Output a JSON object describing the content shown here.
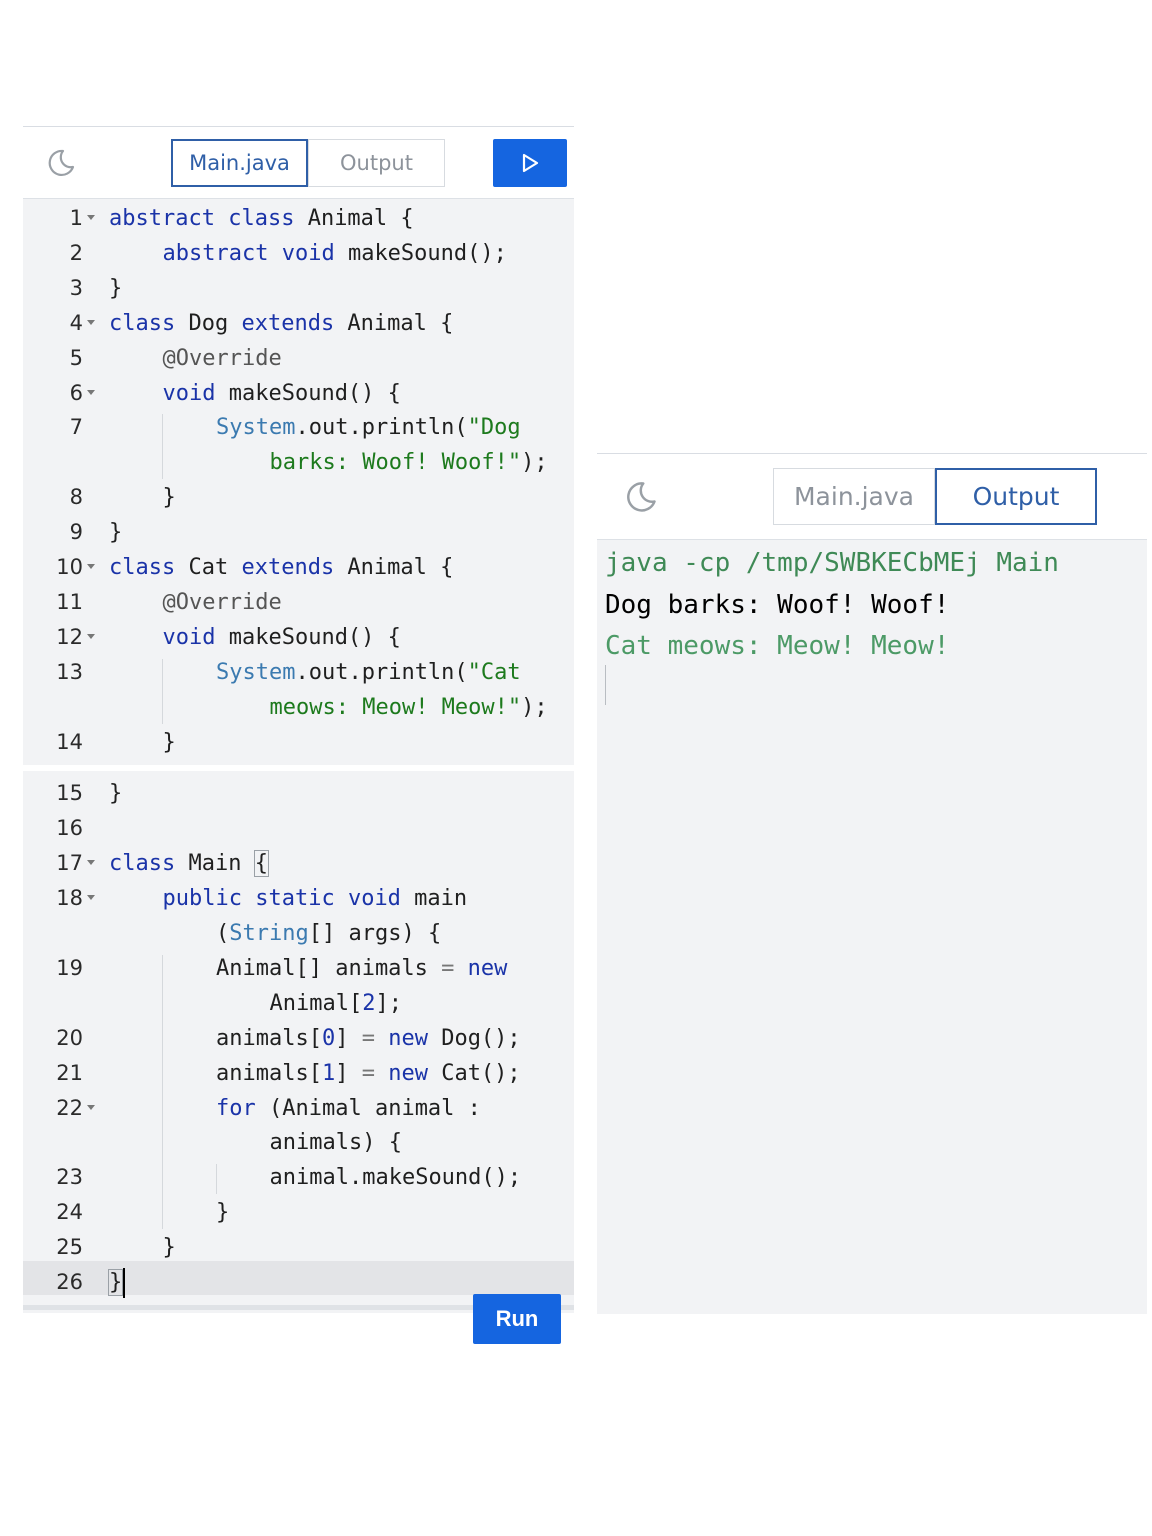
{
  "editor": {
    "tabs": [
      "Main.java",
      "Output"
    ],
    "active_tab": "Main.java",
    "run_label": "Run",
    "lines": [
      {
        "n": "1",
        "fold": true,
        "tokens": [
          [
            "kw",
            "abstract"
          ],
          [
            "",
            ""
          ],
          [
            "kw",
            " class"
          ],
          [
            "",
            " Animal {"
          ]
        ]
      },
      {
        "n": "2",
        "fold": false,
        "indent": 1,
        "tokens": [
          [
            "kw",
            "abstract"
          ],
          [
            "kw",
            " void"
          ],
          [
            "",
            " makeSound();"
          ]
        ]
      },
      {
        "n": "3",
        "fold": false,
        "tokens": [
          [
            "",
            "}"
          ]
        ]
      },
      {
        "n": "4",
        "fold": true,
        "tokens": [
          [
            "kw",
            "class"
          ],
          [
            "",
            " Dog "
          ],
          [
            "kw",
            "extends"
          ],
          [
            "",
            " Animal {"
          ]
        ]
      },
      {
        "n": "5",
        "fold": false,
        "indent": 1,
        "tokens": [
          [
            "an",
            "@Override"
          ]
        ]
      },
      {
        "n": "6",
        "fold": true,
        "indent": 1,
        "tokens": [
          [
            "kw",
            "void"
          ],
          [
            "",
            " makeSound() {"
          ]
        ]
      },
      {
        "n": "7",
        "fold": false,
        "indent": 2,
        "tokens": [
          [
            "ty",
            "System"
          ],
          [
            "",
            ".out.println("
          ],
          [
            "st",
            "\"Dog"
          ]
        ]
      },
      {
        "n": "",
        "fold": false,
        "indent": 3,
        "tokens": [
          [
            "st",
            "barks: Woof! Woof!\""
          ],
          [
            "",
            ");"
          ]
        ]
      },
      {
        "n": "8",
        "fold": false,
        "indent": 1,
        "tokens": [
          [
            "",
            "}"
          ]
        ]
      },
      {
        "n": "9",
        "fold": false,
        "tokens": [
          [
            "",
            "}"
          ]
        ]
      },
      {
        "n": "10",
        "fold": true,
        "tokens": [
          [
            "kw",
            "class"
          ],
          [
            "",
            " Cat "
          ],
          [
            "kw",
            "extends"
          ],
          [
            "",
            " Animal {"
          ]
        ]
      },
      {
        "n": "11",
        "fold": false,
        "indent": 1,
        "tokens": [
          [
            "an",
            "@Override"
          ]
        ]
      },
      {
        "n": "12",
        "fold": true,
        "indent": 1,
        "tokens": [
          [
            "kw",
            "void"
          ],
          [
            "",
            " makeSound() {"
          ]
        ]
      },
      {
        "n": "13",
        "fold": false,
        "indent": 2,
        "tokens": [
          [
            "ty",
            "System"
          ],
          [
            "",
            ".out.println("
          ],
          [
            "st",
            "\"Cat"
          ]
        ]
      },
      {
        "n": "",
        "fold": false,
        "indent": 3,
        "tokens": [
          [
            "st",
            "meows: Meow! Meow!\""
          ],
          [
            "",
            ");"
          ]
        ]
      },
      {
        "n": "14",
        "fold": false,
        "indent": 1,
        "tokens": [
          [
            "",
            "}"
          ]
        ]
      },
      {
        "n": "15",
        "fold": false,
        "tokens": [
          [
            "",
            "}"
          ]
        ]
      },
      {
        "n": "16",
        "fold": false,
        "tokens": []
      },
      {
        "n": "17",
        "fold": true,
        "tokens": [
          [
            "kw",
            "class"
          ],
          [
            "",
            " Main "
          ],
          [
            "box",
            "{"
          ]
        ]
      },
      {
        "n": "18",
        "fold": true,
        "indent": 1,
        "tokens": [
          [
            "kw",
            "public"
          ],
          [
            "kw",
            " static"
          ],
          [
            "kw",
            " void"
          ],
          [
            "",
            " main"
          ]
        ]
      },
      {
        "n": "",
        "fold": false,
        "indent": 2,
        "tokens": [
          [
            "",
            "("
          ],
          [
            "ty",
            "String"
          ],
          [
            "",
            "[] args) {"
          ]
        ]
      },
      {
        "n": "19",
        "fold": false,
        "indent": 2,
        "tokens": [
          [
            "",
            "Animal[] animals "
          ],
          [
            "op",
            "="
          ],
          [
            "kw",
            " new"
          ]
        ]
      },
      {
        "n": "",
        "fold": false,
        "indent": 3,
        "tokens": [
          [
            "",
            "Animal["
          ],
          [
            "nm",
            "2"
          ],
          [
            "",
            "];"
          ]
        ]
      },
      {
        "n": "20",
        "fold": false,
        "indent": 2,
        "tokens": [
          [
            "",
            "animals["
          ],
          [
            "nm",
            "0"
          ],
          [
            "",
            "] "
          ],
          [
            "op",
            "="
          ],
          [
            "kw",
            " new"
          ],
          [
            "",
            " Dog();"
          ]
        ]
      },
      {
        "n": "21",
        "fold": false,
        "indent": 2,
        "tokens": [
          [
            "",
            "animals["
          ],
          [
            "nm",
            "1"
          ],
          [
            "",
            "] "
          ],
          [
            "op",
            "="
          ],
          [
            "kw",
            " new"
          ],
          [
            "",
            " Cat();"
          ]
        ]
      },
      {
        "n": "22",
        "fold": true,
        "indent": 2,
        "tokens": [
          [
            "kw",
            "for"
          ],
          [
            "",
            " (Animal animal :"
          ]
        ]
      },
      {
        "n": "",
        "fold": false,
        "indent": 3,
        "tokens": [
          [
            "",
            "animals) {"
          ]
        ]
      },
      {
        "n": "23",
        "fold": false,
        "indent": 3,
        "tokens": [
          [
            "",
            "animal.makeSound();"
          ]
        ]
      },
      {
        "n": "24",
        "fold": false,
        "indent": 2,
        "tokens": [
          [
            "",
            "}"
          ]
        ]
      },
      {
        "n": "25",
        "fold": false,
        "indent": 1,
        "tokens": [
          [
            "",
            "}"
          ]
        ]
      },
      {
        "n": "26",
        "fold": false,
        "tokens": [
          [
            "box",
            "}"
          ],
          [
            "cursor",
            ""
          ]
        ]
      }
    ]
  },
  "output": {
    "tabs": [
      "Main.java",
      "Output"
    ],
    "active_tab": "Output",
    "lines": [
      {
        "kind": "cmd",
        "text": "java -cp /tmp/SWBKECbMEj Main"
      },
      {
        "kind": "out",
        "text": "Dog barks: Woof! Woof!"
      },
      {
        "kind": "err",
        "text": "Cat meows: Meow! Meow!"
      }
    ]
  },
  "colors": {
    "accent": "#1565e0",
    "tab_active": "#2f5fa7",
    "keyword": "#1a33a8",
    "string": "#1d7a1d"
  },
  "icons": [
    "moon-icon",
    "play-icon"
  ]
}
